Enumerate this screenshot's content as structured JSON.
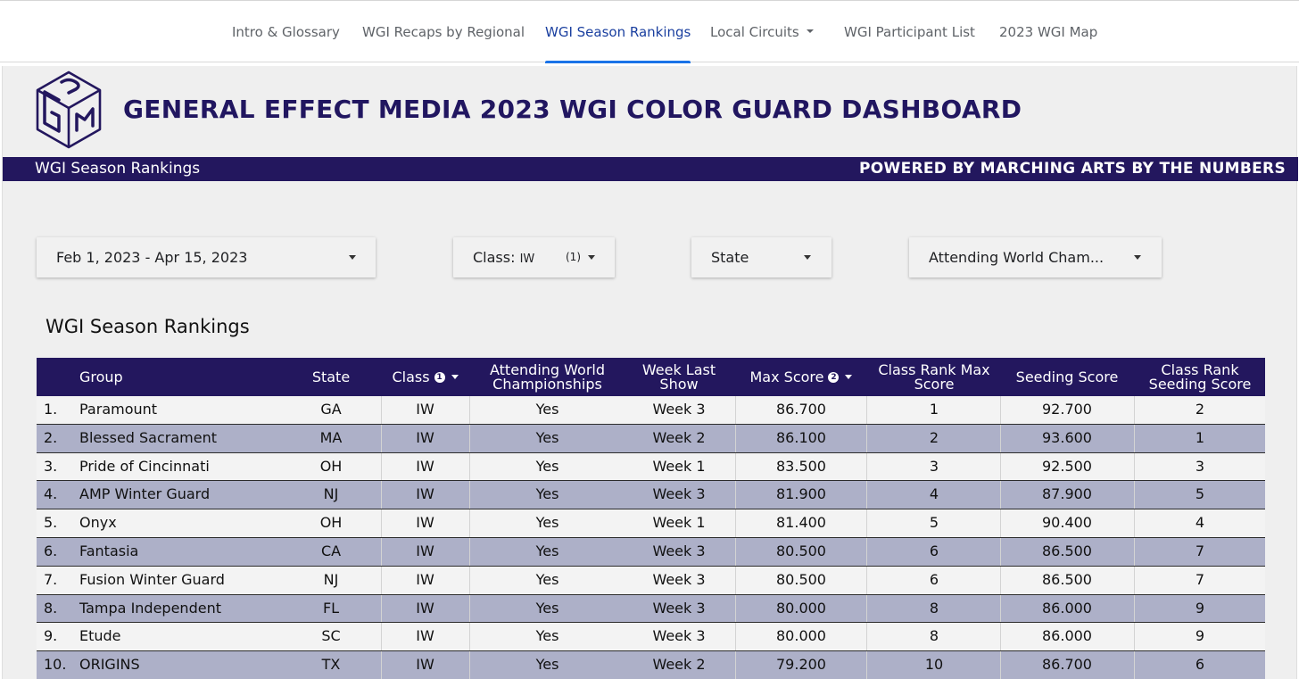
{
  "nav": {
    "items": [
      {
        "label": "Intro & Glossary"
      },
      {
        "label": "WGI Recaps by Regional"
      },
      {
        "label": "WGI Season Rankings"
      },
      {
        "label": "Local Circuits"
      },
      {
        "label": "WGI Participant List"
      },
      {
        "label": "2023 WGI Map"
      }
    ],
    "active_index": 2
  },
  "header": {
    "title": "GENERAL EFFECT MEDIA 2023 WGI COLOR GUARD DASHBOARD",
    "logo_icon": "gem-cube-logo"
  },
  "banner": {
    "left": "WGI Season Rankings",
    "right": "POWERED BY MARCHING ARTS BY THE NUMBERS"
  },
  "filters": {
    "date_range": "Feb 1, 2023 - Apr 15, 2023",
    "class_label": "Class:",
    "class_value": "IW",
    "class_count": "(1)",
    "state": "State",
    "attending": "Attending World Cham..."
  },
  "section_title": "WGI Season Rankings",
  "table": {
    "columns": [
      {
        "label": "Group"
      },
      {
        "label": "State"
      },
      {
        "label": "Class",
        "info": "1",
        "sort": true
      },
      {
        "label": "Attending World Championships"
      },
      {
        "label": "Week Last Show"
      },
      {
        "label": "Max Score",
        "info": "2",
        "sort": true
      },
      {
        "label": "Class Rank Max Score"
      },
      {
        "label": "Seeding Score"
      },
      {
        "label": "Class Rank Seeding Score"
      }
    ],
    "rows": [
      {
        "rank": "1.",
        "group": "Paramount",
        "state": "GA",
        "class": "IW",
        "attending": "Yes",
        "week": "Week 3",
        "max_score": "86.700",
        "class_rank_max": "1",
        "seeding_score": "92.700",
        "class_rank_seeding": "2"
      },
      {
        "rank": "2.",
        "group": "Blessed Sacrament",
        "state": "MA",
        "class": "IW",
        "attending": "Yes",
        "week": "Week 2",
        "max_score": "86.100",
        "class_rank_max": "2",
        "seeding_score": "93.600",
        "class_rank_seeding": "1"
      },
      {
        "rank": "3.",
        "group": "Pride of Cincinnati",
        "state": "OH",
        "class": "IW",
        "attending": "Yes",
        "week": "Week 1",
        "max_score": "83.500",
        "class_rank_max": "3",
        "seeding_score": "92.500",
        "class_rank_seeding": "3"
      },
      {
        "rank": "4.",
        "group": "AMP Winter Guard",
        "state": "NJ",
        "class": "IW",
        "attending": "Yes",
        "week": "Week 3",
        "max_score": "81.900",
        "class_rank_max": "4",
        "seeding_score": "87.900",
        "class_rank_seeding": "5"
      },
      {
        "rank": "5.",
        "group": "Onyx",
        "state": "OH",
        "class": "IW",
        "attending": "Yes",
        "week": "Week 1",
        "max_score": "81.400",
        "class_rank_max": "5",
        "seeding_score": "90.400",
        "class_rank_seeding": "4"
      },
      {
        "rank": "6.",
        "group": "Fantasia",
        "state": "CA",
        "class": "IW",
        "attending": "Yes",
        "week": "Week 3",
        "max_score": "80.500",
        "class_rank_max": "6",
        "seeding_score": "86.500",
        "class_rank_seeding": "7"
      },
      {
        "rank": "7.",
        "group": "Fusion Winter Guard",
        "state": "NJ",
        "class": "IW",
        "attending": "Yes",
        "week": "Week 3",
        "max_score": "80.500",
        "class_rank_max": "6",
        "seeding_score": "86.500",
        "class_rank_seeding": "7"
      },
      {
        "rank": "8.",
        "group": "Tampa Independent",
        "state": "FL",
        "class": "IW",
        "attending": "Yes",
        "week": "Week 3",
        "max_score": "80.000",
        "class_rank_max": "8",
        "seeding_score": "86.000",
        "class_rank_seeding": "9"
      },
      {
        "rank": "9.",
        "group": "Etude",
        "state": "SC",
        "class": "IW",
        "attending": "Yes",
        "week": "Week 3",
        "max_score": "80.000",
        "class_rank_max": "8",
        "seeding_score": "86.000",
        "class_rank_seeding": "9"
      },
      {
        "rank": "10.",
        "group": "ORIGINS",
        "state": "TX",
        "class": "IW",
        "attending": "Yes",
        "week": "Week 2",
        "max_score": "79.200",
        "class_rank_max": "10",
        "seeding_score": "86.700",
        "class_rank_seeding": "6"
      }
    ]
  },
  "colors": {
    "brand_navy": "#23175e",
    "title_navy": "#211660",
    "row_alt": "#adb0c8",
    "active_tab": "#1a73e8"
  }
}
